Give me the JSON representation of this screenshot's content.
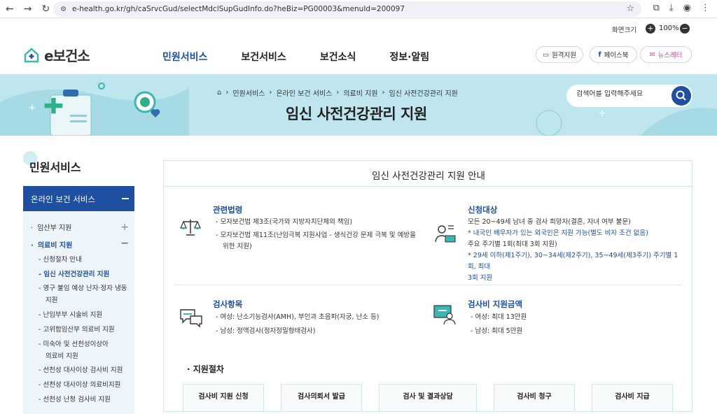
{
  "browser": {
    "url": "e-health.go.kr/gh/caSrvcGud/selectMdclSupGudInfo.do?heBiz=PG00003&menuId=200097",
    "nav_icons": [
      "back-arrow-icon",
      "forward-arrow-icon",
      "reload-icon"
    ]
  },
  "zoom": {
    "label": "화면크기",
    "value": "100%"
  },
  "logo": {
    "text": "e보건소"
  },
  "gnb": [
    "민원서비스",
    "보건서비스",
    "보건소식",
    "정보·알림"
  ],
  "header_buttons": {
    "remote": "원격지원",
    "facebook": "페이스북",
    "newsletter": "뉴스레터"
  },
  "breadcrumb": [
    "민원서비스",
    "온라인 보건 서비스",
    "의료비 지원",
    "임신 사전건강관리 지원"
  ],
  "page_title": "임신 사전건강관리 지원",
  "search": {
    "placeholder": "검색어를 입력해주세요"
  },
  "sidebar": {
    "title": "민원서비스",
    "section": "온라인 보건 서비스",
    "level1": [
      {
        "label": "임산부 지원",
        "expanded": false
      },
      {
        "label": "의료비 지원",
        "expanded": true
      }
    ],
    "level2": [
      "신청절차 안내",
      "임신 사전건강관리 지원",
      "영구 불임 예상 난자·정자 냉동",
      "지원",
      "난임부부 시술비 지원",
      "고위험임산부 의료비 지원",
      "미숙아 및 선천성이상아",
      "의료비 지원",
      "선천성 대사이상 검사비 지원",
      "선천성 대사이상 의료비지원",
      "선천성 난청 검사비 지원"
    ]
  },
  "content": {
    "title": "임신 사전건강관리 지원 안내",
    "law": {
      "heading": "관련법령",
      "items": [
        "모자보건법 제3조(국가와 지방자치단체의 책임)",
        "모자보건법 제11조(난임극복 지원사업 - 생식건강 문제 극복 및 예방을",
        "위한 지원)"
      ]
    },
    "target": {
      "heading": "신청대상",
      "lines": [
        "모든 20~49세 남녀 중 검사 희망자(결혼, 자녀 여부 불문)",
        "* 내국인 배우자가 있는 외국인은 지원 가능(별도 비자 조건 없음)",
        "주요 주기별 1회(최대 3회 지원)",
        "* 29세 이하(제1주기), 30~34세(제2주기), 35~49세(제3주기) 주기별 1회, 최대",
        "3회 지원"
      ]
    },
    "tests": {
      "heading": "검사항목",
      "items": [
        "여성: 난소기능검사(AMH), 부인과 초음파(자궁, 난소 등)",
        "남성: 정액검사(정자정밀형태검사)"
      ]
    },
    "amount": {
      "heading": "검사비 지원금액",
      "items": [
        "여성: 최대 13만원",
        "남성: 최대 5만원"
      ]
    },
    "procedure": {
      "heading": "· 지원절차",
      "steps": [
        "검사비 지원 신청",
        "검사의뢰서 발급",
        "검사 및 결과상담",
        "검사비 청구",
        "검사비 지급"
      ]
    }
  }
}
